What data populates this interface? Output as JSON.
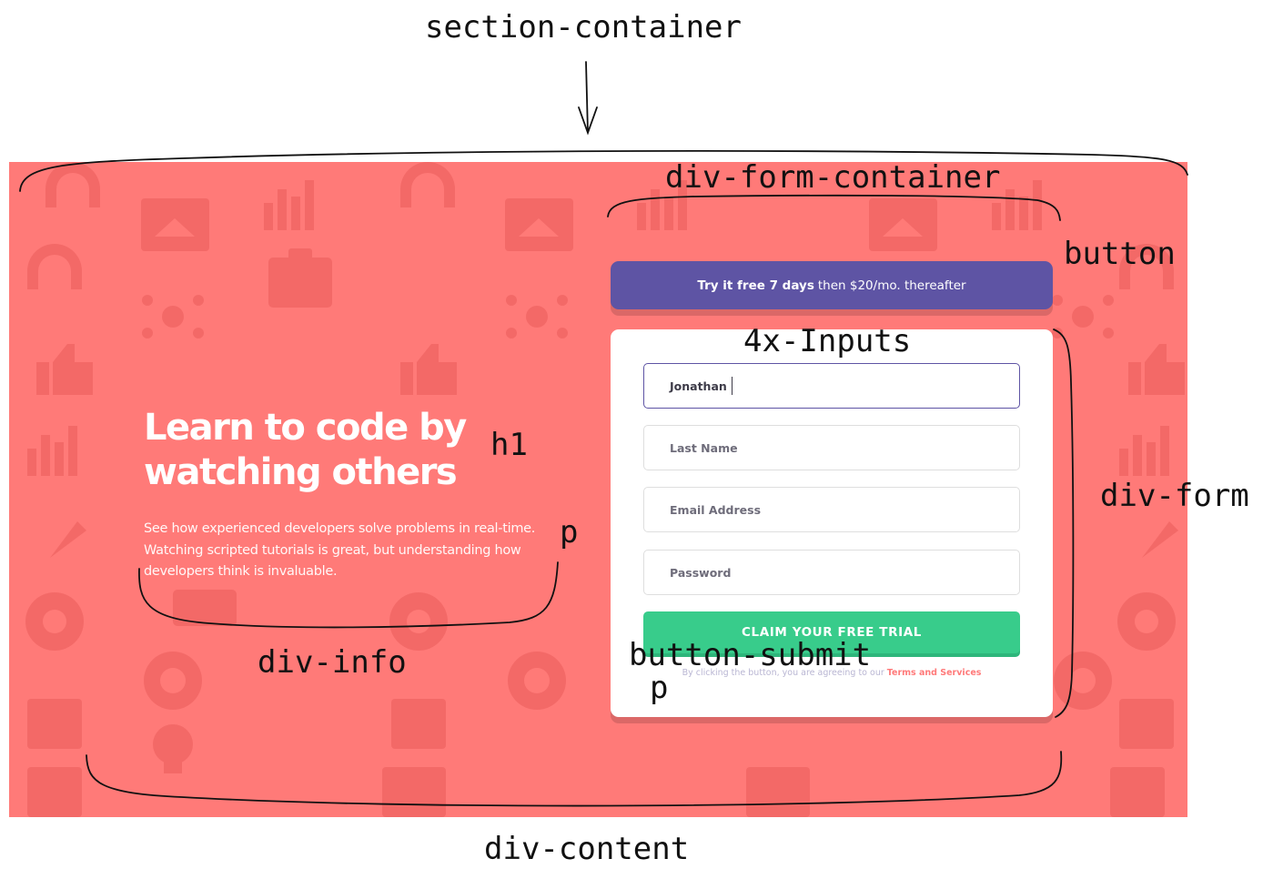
{
  "annotations": {
    "section_container": "section-container",
    "div_form_container": "div-form-container",
    "button": "button",
    "inputs": "4x-Inputs",
    "h1": "h1",
    "p_info": "p",
    "div_form": "div-form",
    "div_info": "div-info",
    "button_submit": "button-submit",
    "p_form": "p",
    "div_content": "div-content"
  },
  "hero": {
    "title": "Learn to code by\nwatching others",
    "description": "See how experienced developers solve problems in real-time. Watching scripted tutorials is great, but understanding how developers think is invaluable."
  },
  "promo": {
    "bold": "Try it free 7 days",
    "rest": "then $20/mo. thereafter"
  },
  "form": {
    "first_name_value": "Jonathan",
    "last_name_placeholder": "Last Name",
    "email_placeholder": "Email Address",
    "password_placeholder": "Password",
    "submit_label": "CLAIM YOUR FREE TRIAL",
    "terms_prefix": "By clicking the button, you are agreeing to our",
    "terms_link": "Terms and Services"
  },
  "colors": {
    "background": "#ff7a78",
    "promo": "#5e54a4",
    "submit": "#38cc8b",
    "link": "#ff7a7a",
    "annotation": "#111111"
  },
  "icons": [
    "headset-icon",
    "bar-chart-icon",
    "browser-window-icon",
    "toolbox-icon",
    "network-icon",
    "thumbs-up-icon",
    "rocket-icon",
    "gear-icon",
    "lifebuoy-icon",
    "calendar-icon",
    "lightbulb-icon",
    "sitemap-icon"
  ]
}
